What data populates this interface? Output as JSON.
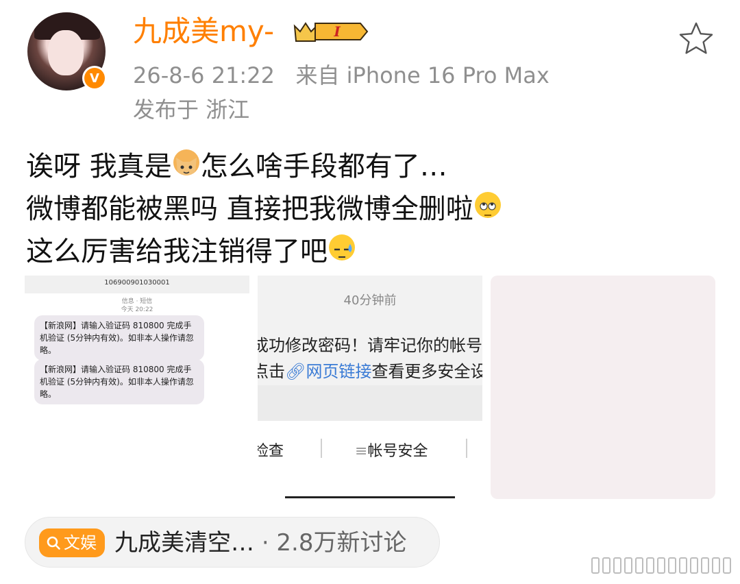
{
  "user": {
    "name": "九成美my-",
    "level_badge": "I",
    "time": "26-8-6 21:22",
    "source_prefix": "来自",
    "source": "iPhone 16 Pro Max",
    "location": "发布于 浙江"
  },
  "post": {
    "line1_a": "诶呀 我真是",
    "line1_b": "怎么啥手段都有了…",
    "line2": "微博都能被黑吗 直接把我微博全删啦",
    "line3": "这么厉害给我注销得了吧"
  },
  "images": {
    "sms": {
      "sender": "106900901030001",
      "meta1": "信息 · 短信",
      "meta2": "今天 20:22",
      "messages": [
        "【新浪网】请输入验证码 810800 完成手机验证 (5分钟内有效)。如非本人操作请忽略。",
        "【新浪网】请输入验证码 810800 完成手机验证 (5分钟内有效)。如非本人操作请忽略。"
      ]
    },
    "notice": {
      "time": "40分钟前",
      "line1": "成功修改密码！请牢记你的帐号",
      "line2_prefix": "点击",
      "link_label": "网页链接",
      "line2_suffix": "查看更多安全设",
      "button1": "检查",
      "button2": "帐号安全"
    }
  },
  "topic": {
    "tag": "文娱",
    "text": "九成美清空…",
    "count": "· 2.8万新讨论"
  },
  "colors": {
    "brand_orange": "#ff7f00",
    "meta_grey": "#8f8f8f",
    "topic_tag": "#ff9a1c",
    "link_blue": "#3a7bd5"
  },
  "icons": [
    "verified-icon",
    "crown-badge-icon",
    "favorite-star-icon",
    "cat-emoji-icon",
    "eye-roll-emoji-icon",
    "sweat-emoji-icon",
    "search-icon",
    "link-icon"
  ]
}
